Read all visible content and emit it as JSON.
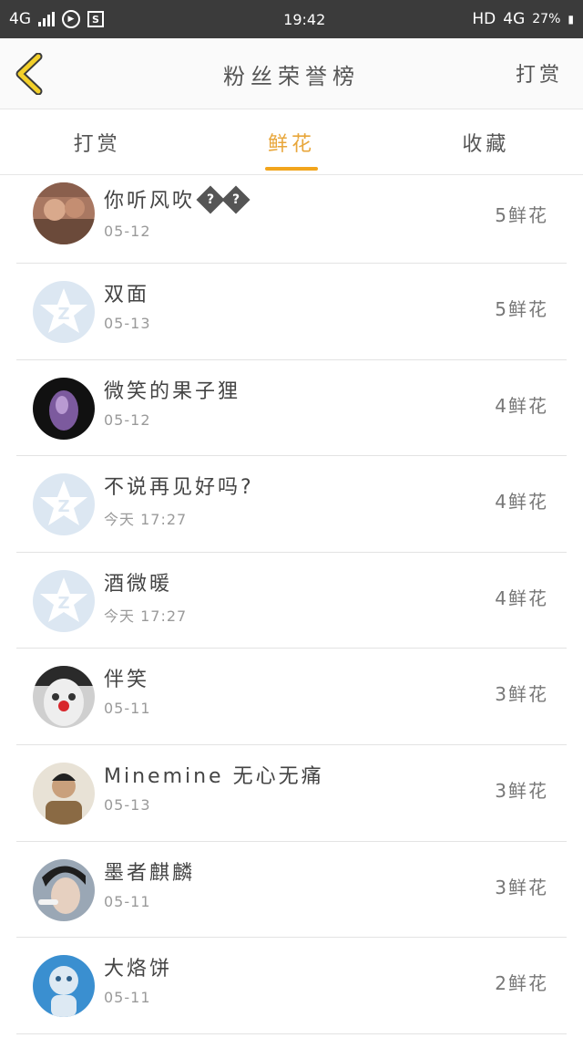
{
  "status_bar": {
    "network_left": "4G",
    "time": "19:42",
    "hd": "HD",
    "network_right": "4G",
    "battery": "27%"
  },
  "header": {
    "title": "粉丝荣誉榜",
    "action": "打赏"
  },
  "tabs": [
    {
      "label": "打赏",
      "active": false
    },
    {
      "label": "鲜花",
      "active": true
    },
    {
      "label": "收藏",
      "active": false
    }
  ],
  "fans": [
    {
      "name": "你听风吹",
      "date": "05-12",
      "count": "5鲜花",
      "avatar": "photo-couple-icon"
    },
    {
      "name": "双面",
      "date": "05-13",
      "count": "5鲜花",
      "avatar": "default-star-avatar-icon"
    },
    {
      "name": "微笑的果子狸",
      "date": "05-12",
      "count": "4鲜花",
      "avatar": "purple-crystal-icon"
    },
    {
      "name": "不说再见好吗?",
      "date": "今天 17:27",
      "count": "4鲜花",
      "avatar": "default-star-avatar-icon"
    },
    {
      "name": "酒微暖",
      "date": "今天 17:27",
      "count": "4鲜花",
      "avatar": "default-star-avatar-icon"
    },
    {
      "name": "伴笑",
      "date": "05-11",
      "count": "3鲜花",
      "avatar": "clown-face-icon"
    },
    {
      "name": "Minemine 无心无痛",
      "date": "05-13",
      "count": "3鲜花",
      "avatar": "person-portrait-icon"
    },
    {
      "name": "墨者麒麟",
      "date": "05-11",
      "count": "3鲜花",
      "avatar": "young-man-portrait-icon"
    },
    {
      "name": "大烙饼",
      "date": "05-11",
      "count": "2鲜花",
      "avatar": "blue-doll-icon"
    }
  ],
  "colors": {
    "accent": "#f2a51c",
    "status_bar": "#3b3b3b",
    "default_avatar": "#d9e6f3"
  }
}
